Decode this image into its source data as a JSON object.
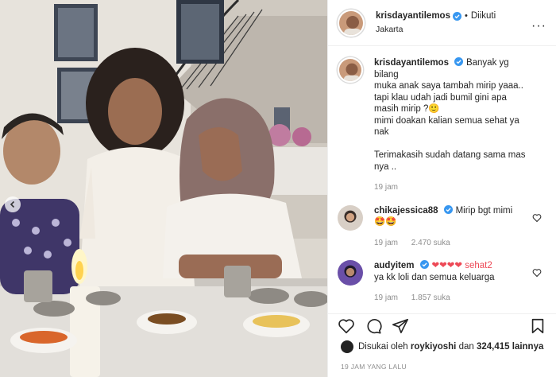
{
  "post": {
    "username": "krisdayantilemos",
    "follow_status": "Diikuti",
    "location": "Jakarta",
    "more_icon": "more-horizontal-icon"
  },
  "caption": {
    "username": "krisdayantilemos",
    "lines": [
      "Banyak yg bilang",
      "muka anak saya tambah mirip yaaa..",
      "tapi klau udah jadi bumil gini apa",
      "masih mirip ?🙂",
      "mimi doakan kalian semua sehat ya",
      "nak",
      "",
      "Terimakasih sudah datang sama mas",
      "nya .."
    ],
    "time": "19 jam"
  },
  "comments": [
    {
      "username": "chikajessica88",
      "lines": [
        "Mirip bgt mimi",
        "🤩🤩"
      ],
      "time": "19 jam",
      "likes": "2.470 suka"
    },
    {
      "username": "audyitem",
      "lines": [
        "❤❤❤❤ sehat2",
        "ya kk loli dan semua keluarga"
      ],
      "time": "19 jam",
      "likes": "1.857 suka"
    }
  ],
  "likes": {
    "prefix": "Disukai oleh",
    "user": "roykiyoshi",
    "joiner": "dan",
    "count": "324,415 lainnya"
  },
  "timestamp": "19 JAM YANG LALU",
  "colors": {
    "verified": "#3897f0",
    "text": "#262626",
    "muted": "#8e8e8e",
    "border": "#efefef"
  }
}
